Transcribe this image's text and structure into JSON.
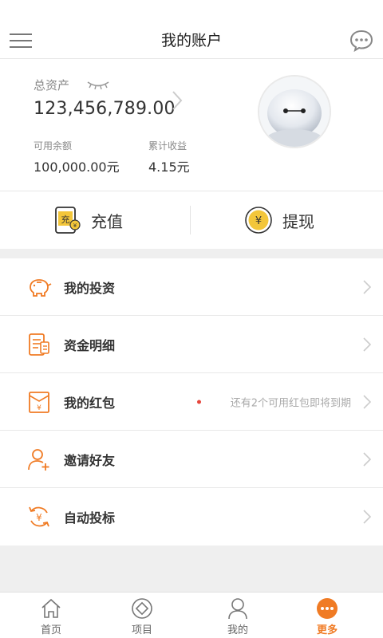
{
  "header": {
    "title": "我的账户",
    "menu_icon": "hamburger-menu-icon",
    "chat_icon": "chat-bubble-icon"
  },
  "assets": {
    "total_label": "总资产",
    "total_value": "123,456,789.00",
    "available_label": "可用余额",
    "available_value": "100,000.00元",
    "earnings_label": "累计收益",
    "earnings_value": "4.15元"
  },
  "actions": {
    "recharge_label": "充值",
    "withdraw_label": "提现"
  },
  "menu": {
    "items": [
      {
        "label": "我的投资",
        "icon": "piggy-bank-icon"
      },
      {
        "label": "资金明细",
        "icon": "ledger-document-icon"
      },
      {
        "label": "我的红包",
        "icon": "red-envelope-icon",
        "note": "还有2个可用红包即将到期"
      },
      {
        "label": "邀请好友",
        "icon": "add-friend-icon"
      },
      {
        "label": "自动投标",
        "icon": "auto-bid-icon"
      }
    ]
  },
  "tabbar": {
    "tabs": [
      {
        "label": "首页",
        "icon": "home-icon"
      },
      {
        "label": "项目",
        "icon": "project-icon"
      },
      {
        "label": "我的",
        "icon": "user-icon"
      },
      {
        "label": "更多",
        "icon": "more-icon",
        "active": true
      }
    ]
  },
  "colors": {
    "accent": "#f07b24",
    "badge_dot": "#e6463c",
    "gold": "#f3c63a"
  }
}
